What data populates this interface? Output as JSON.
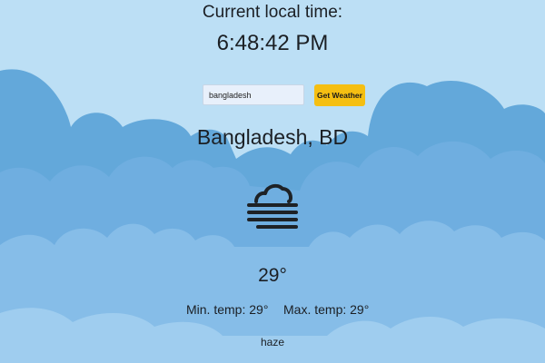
{
  "header": {
    "time_label": "Current local time:",
    "time_value": "6:48:42 PM"
  },
  "search": {
    "value": "bangladesh",
    "button_label": "Get Weather"
  },
  "weather": {
    "location": "Bangladesh, BD",
    "icon": "haze-icon",
    "temperature": "29°",
    "min_temp": "Min. temp: 29°",
    "max_temp": "Max. temp: 29°",
    "description": "haze"
  },
  "colors": {
    "sky": "#bcdff5",
    "cloud_back": "#62a8da",
    "cloud_mid": "#70b1e0",
    "cloud_front": "#8dc3ea",
    "button": "#f5bf12"
  }
}
